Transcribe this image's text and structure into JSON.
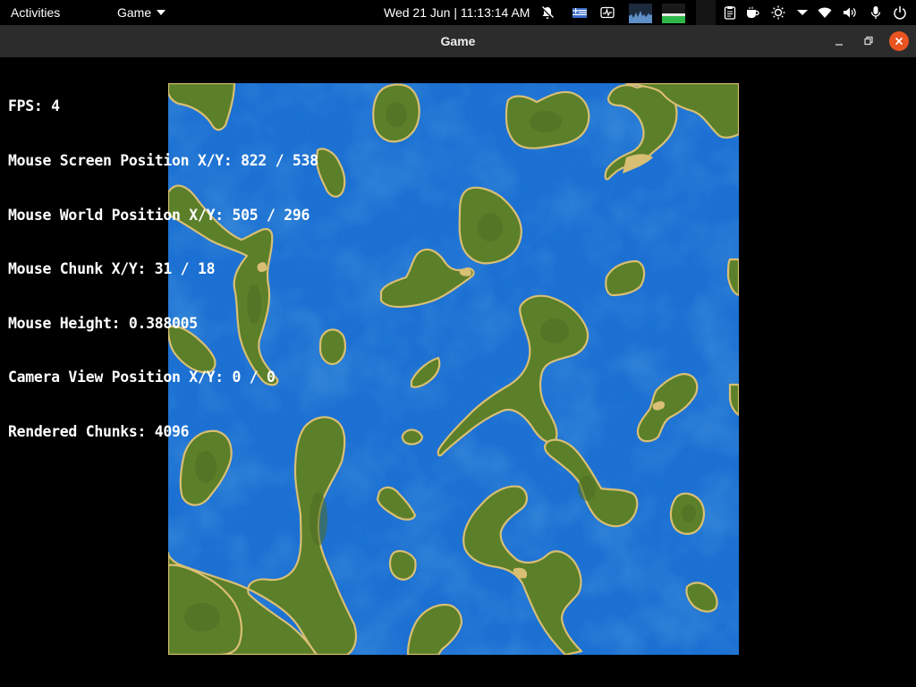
{
  "topbar": {
    "activities_label": "Activities",
    "app_menu_label": "Game",
    "clock": "Wed 21 Jun | 11:13:14 AM",
    "tray_icons": [
      "notifications-muted-icon",
      "flag-icon",
      "system-monitor-icon",
      "cpu-graph-icon",
      "net-graph-icon",
      "clipboard-icon",
      "coffee-icon",
      "brightness-icon",
      "menu-arrow-icon",
      "wifi-icon",
      "volume-icon",
      "microphone-icon",
      "power-icon"
    ]
  },
  "window": {
    "title": "Game",
    "controls": [
      "minimize-icon",
      "maximize-icon",
      "close-icon"
    ]
  },
  "hud": {
    "fps": "FPS: 4",
    "mouse_screen": "Mouse Screen Position X/Y: 822 / 538",
    "mouse_world": "Mouse World Position X/Y: 505 / 296",
    "mouse_chunk": "Mouse Chunk X/Y: 31 / 18",
    "mouse_height": "Mouse Height: 0.388005",
    "camera_view": "Camera View Position X/Y: 0 / 0",
    "rendered_chunks": "Rendered Chunks: 4096"
  },
  "colors": {
    "water": "#1a6fd2",
    "deep_water": "#1556b0",
    "grass": "#5c7f29",
    "grass_dark": "#4d6e22",
    "sand": "#d8bf73",
    "close_button": "#e95420",
    "titlebar": "#2c2c2c"
  }
}
